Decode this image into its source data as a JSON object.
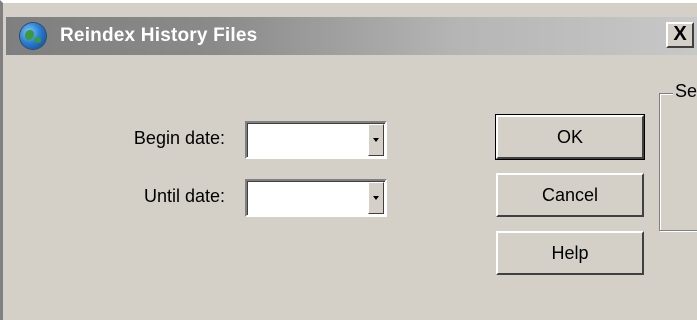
{
  "window": {
    "title": "Reindex History Files",
    "close_glyph": "X"
  },
  "form": {
    "begin_label": "Begin date:",
    "begin_value": "",
    "until_label": "Until date:",
    "until_value": ""
  },
  "buttons": {
    "ok": "OK",
    "cancel": "Cancel",
    "help": "Help"
  },
  "group": {
    "label": "Se"
  },
  "icons": {
    "app": "globe-icon",
    "dropdown": "dropdown-arrow-icon"
  }
}
